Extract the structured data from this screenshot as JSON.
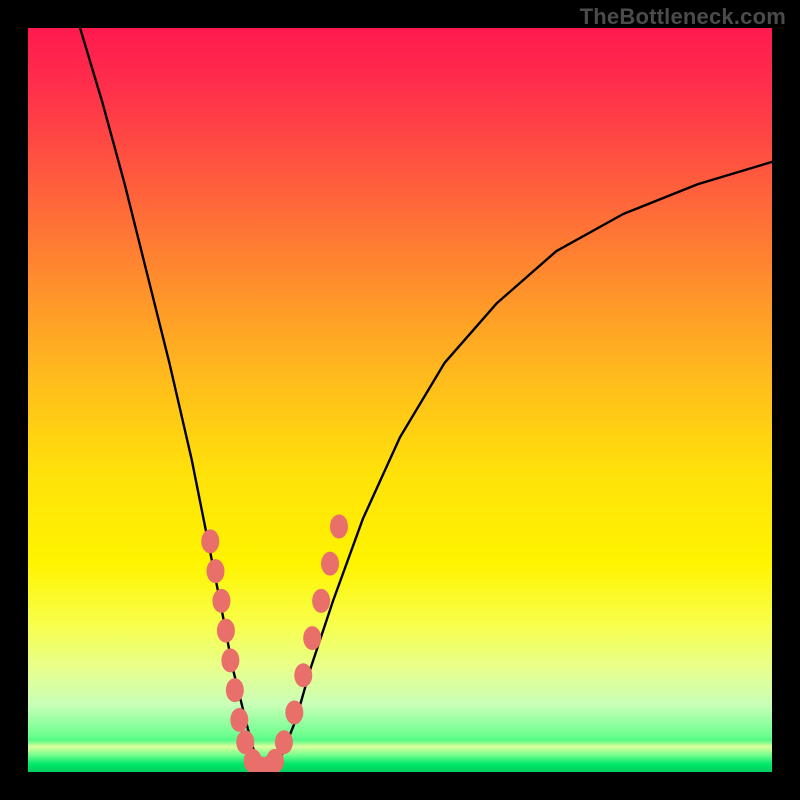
{
  "watermark": "TheBottleneck.com",
  "colors": {
    "curve": "#000000",
    "bead": "#e96f6a",
    "frame": "#000000"
  },
  "chart_data": {
    "type": "line",
    "title": "",
    "xlabel": "",
    "ylabel": "",
    "xlim": [
      0,
      100
    ],
    "ylim": [
      0,
      100
    ],
    "grid": false,
    "legend": false,
    "series": [
      {
        "name": "bottleneck-curve",
        "x": [
          7,
          10,
          13,
          16,
          19,
          22,
          24,
          26,
          27.5,
          29,
          30,
          31,
          32,
          34,
          36,
          38,
          41,
          45,
          50,
          56,
          63,
          71,
          80,
          90,
          100
        ],
        "y": [
          100,
          90,
          79,
          67,
          55,
          42,
          32,
          22,
          14,
          8,
          4,
          1,
          0,
          2,
          7,
          14,
          23,
          34,
          45,
          55,
          63,
          70,
          75,
          79,
          82
        ]
      }
    ],
    "annotations": [
      {
        "kind": "beads",
        "note": "salmon dots clustered near valley on both arms",
        "points_xy": [
          [
            24.5,
            31
          ],
          [
            25.2,
            27
          ],
          [
            26.0,
            23
          ],
          [
            26.6,
            19
          ],
          [
            27.2,
            15
          ],
          [
            27.8,
            11
          ],
          [
            28.4,
            7
          ],
          [
            29.2,
            4
          ],
          [
            30.2,
            1.5
          ],
          [
            31.2,
            0.5
          ],
          [
            32.2,
            0.5
          ],
          [
            33.2,
            1.5
          ],
          [
            34.4,
            4
          ],
          [
            35.8,
            8
          ],
          [
            37.0,
            13
          ],
          [
            38.2,
            18
          ],
          [
            39.4,
            23
          ],
          [
            40.6,
            28
          ],
          [
            41.8,
            33
          ]
        ]
      }
    ],
    "vertex": {
      "x": 32,
      "y": 0
    }
  }
}
